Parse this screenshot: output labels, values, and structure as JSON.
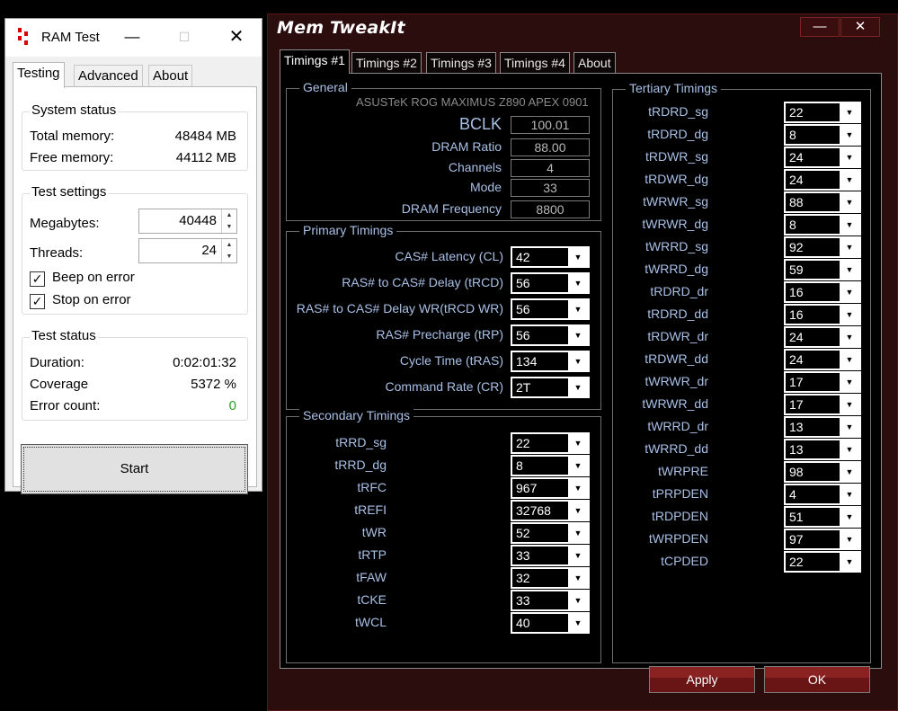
{
  "ram_test": {
    "title": "RAM Test",
    "tabs": [
      "Testing",
      "Advanced",
      "About"
    ],
    "system_status": {
      "title": "System status",
      "total_label": "Total memory:",
      "total_value": "48484 MB",
      "free_label": "Free memory:",
      "free_value": "44112 MB"
    },
    "test_settings": {
      "title": "Test settings",
      "megabytes_label": "Megabytes:",
      "megabytes_value": "40448",
      "threads_label": "Threads:",
      "threads_value": "24",
      "beep_label": "Beep on error",
      "beep_checked": true,
      "stop_label": "Stop on error",
      "stop_checked": true
    },
    "test_status": {
      "title": "Test status",
      "duration_label": "Duration:",
      "duration_value": "0:02:01:32",
      "coverage_label": "Coverage",
      "coverage_value": "5372 %",
      "errors_label": "Error count:",
      "errors_value": "0"
    },
    "start_label": "Start",
    "error_color": "#2e9e2e"
  },
  "mem_tweakit": {
    "title": "Mem TweakIt",
    "tabs": [
      "Timings #1",
      "Timings #2",
      "Timings #3",
      "Timings #4",
      "About"
    ],
    "general": {
      "title": "General",
      "board": "ASUSTeK ROG MAXIMUS Z890 APEX 0901",
      "rows": [
        {
          "label": "BCLK",
          "value": "100.01"
        },
        {
          "label": "DRAM Ratio",
          "value": "88.00"
        },
        {
          "label": "Channels",
          "value": "4"
        },
        {
          "label": "Mode",
          "value": "33"
        },
        {
          "label": "DRAM Frequency",
          "value": "8800"
        }
      ]
    },
    "primary": {
      "title": "Primary Timings",
      "rows": [
        {
          "label": "CAS# Latency (CL)",
          "value": "42"
        },
        {
          "label": "RAS# to CAS# Delay (tRCD)",
          "value": "56"
        },
        {
          "label": "RAS# to CAS# Delay WR(tRCD WR)",
          "value": "56"
        },
        {
          "label": "RAS# Precharge (tRP)",
          "value": "56"
        },
        {
          "label": "Cycle Time (tRAS)",
          "value": "134"
        },
        {
          "label": "Command Rate (CR)",
          "value": "2T"
        }
      ]
    },
    "secondary": {
      "title": "Secondary Timings",
      "rows": [
        {
          "label": "tRRD_sg",
          "value": "22"
        },
        {
          "label": "tRRD_dg",
          "value": "8"
        },
        {
          "label": "tRFC",
          "value": "967"
        },
        {
          "label": "tREFI",
          "value": "32768"
        },
        {
          "label": "tWR",
          "value": "52"
        },
        {
          "label": "tRTP",
          "value": "33"
        },
        {
          "label": "tFAW",
          "value": "32"
        },
        {
          "label": "tCKE",
          "value": "33"
        },
        {
          "label": "tWCL",
          "value": "40"
        }
      ]
    },
    "tertiary": {
      "title": "Tertiary Timings",
      "rows": [
        {
          "label": "tRDRD_sg",
          "value": "22"
        },
        {
          "label": "tRDRD_dg",
          "value": "8"
        },
        {
          "label": "tRDWR_sg",
          "value": "24"
        },
        {
          "label": "tRDWR_dg",
          "value": "24"
        },
        {
          "label": "tWRWR_sg",
          "value": "88"
        },
        {
          "label": "tWRWR_dg",
          "value": "8"
        },
        {
          "label": "tWRRD_sg",
          "value": "92"
        },
        {
          "label": "tWRRD_dg",
          "value": "59"
        },
        {
          "label": "tRDRD_dr",
          "value": "16"
        },
        {
          "label": "tRDRD_dd",
          "value": "16"
        },
        {
          "label": "tRDWR_dr",
          "value": "24"
        },
        {
          "label": "tRDWR_dd",
          "value": "24"
        },
        {
          "label": "tWRWR_dr",
          "value": "17"
        },
        {
          "label": "tWRWR_dd",
          "value": "17"
        },
        {
          "label": "tWRRD_dr",
          "value": "13"
        },
        {
          "label": "tWRRD_dd",
          "value": "13"
        },
        {
          "label": "tWRPRE",
          "value": "98"
        },
        {
          "label": "tPRPDEN",
          "value": "4"
        },
        {
          "label": "tRDPDEN",
          "value": "51"
        },
        {
          "label": "tWRPDEN",
          "value": "97"
        },
        {
          "label": "tCPDED",
          "value": "22"
        }
      ]
    },
    "apply_label": "Apply",
    "ok_label": "OK"
  }
}
